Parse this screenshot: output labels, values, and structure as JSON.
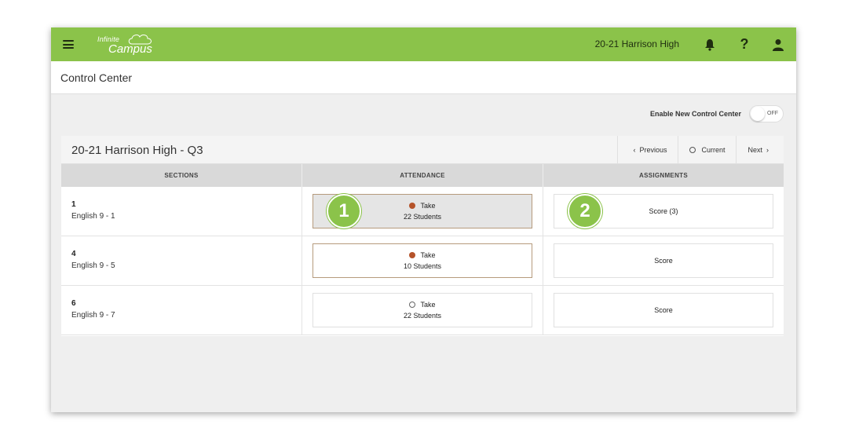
{
  "topbar": {
    "logo_line1": "Infinite",
    "logo_line2": "Campus",
    "school": "20-21 Harrison High",
    "help_label": "?"
  },
  "page": {
    "title": "Control Center"
  },
  "toggle": {
    "label": "Enable New Control Center",
    "state": "OFF"
  },
  "panel": {
    "title": "20-21 Harrison High - Q3",
    "nav": {
      "previous": "Previous",
      "current": "Current",
      "next": "Next"
    }
  },
  "table": {
    "headers": [
      "SECTIONS",
      "ATTENDANCE",
      "ASSIGNMENTS"
    ],
    "rows": [
      {
        "num": "1",
        "name": "English 9 - 1",
        "take": "Take",
        "students": "22 Students",
        "score": "Score (3)"
      },
      {
        "num": "4",
        "name": "English 9 - 5",
        "take": "Take",
        "students": "10 Students",
        "score": "Score"
      },
      {
        "num": "6",
        "name": "English 9 - 7",
        "take": "Take",
        "students": "22 Students",
        "score": "Score"
      }
    ]
  },
  "badges": {
    "b1": "1",
    "b2": "2"
  },
  "colors": {
    "brand": "#8bc34a",
    "attendance_dot": "#b5532a"
  }
}
